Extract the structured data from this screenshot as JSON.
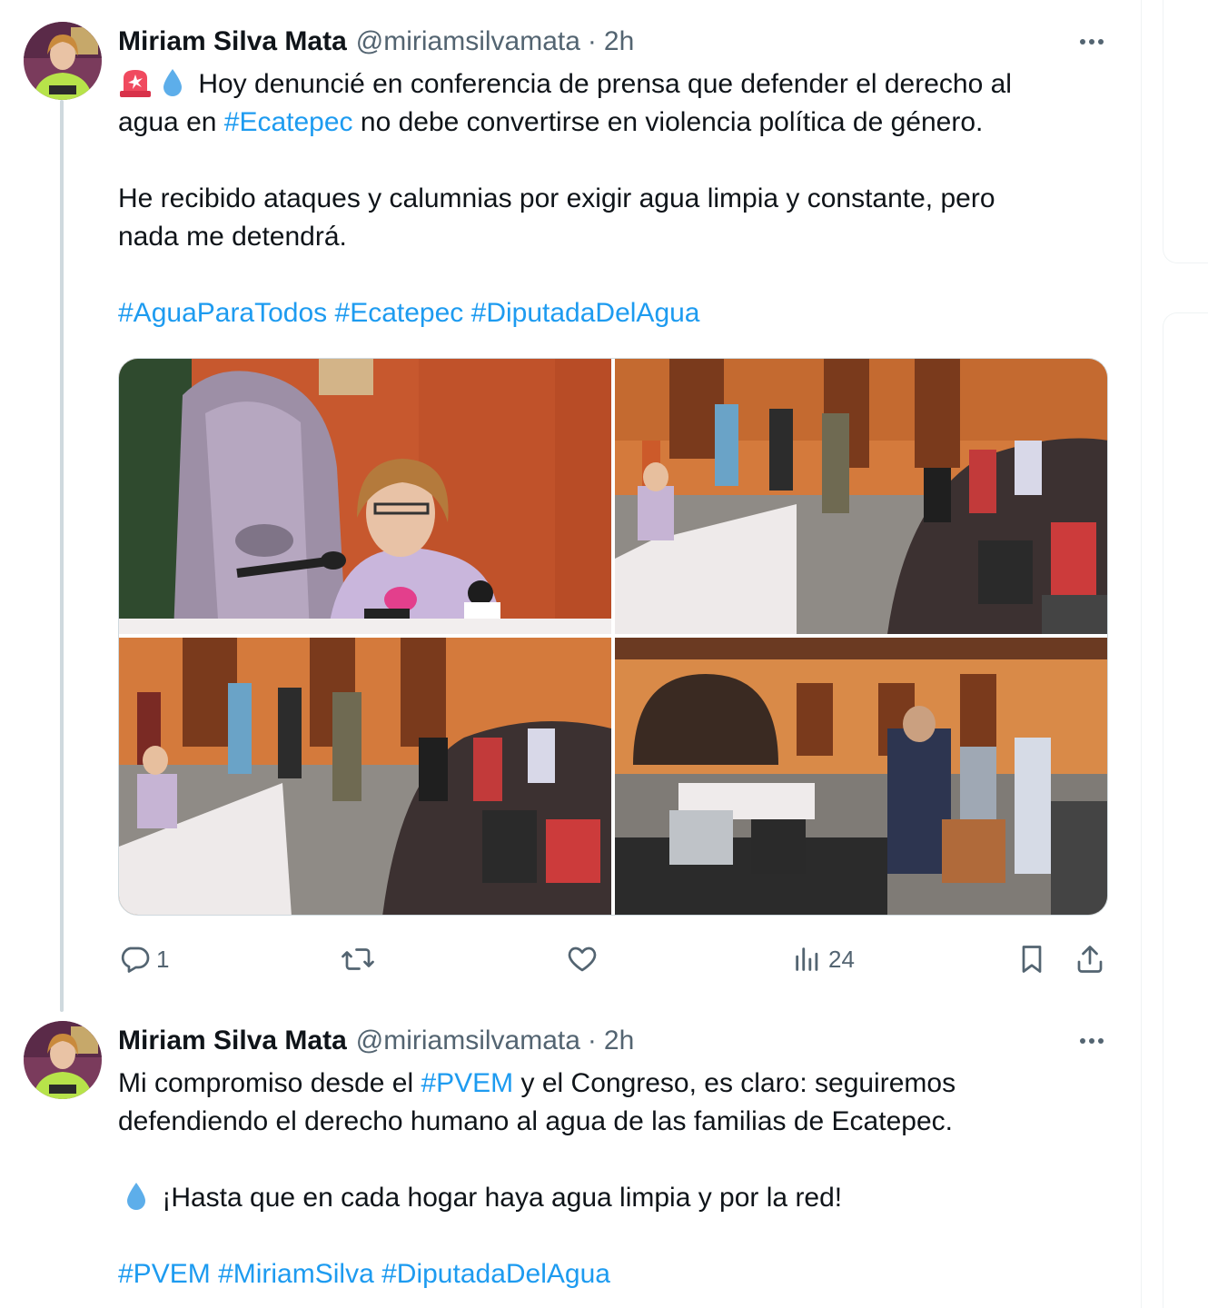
{
  "tweets": [
    {
      "author_name": "Miriam Silva Mata",
      "handle": "@miriamsilvamata",
      "separator": "·",
      "time": "2h",
      "lines": [
        [
          "🚨💧",
          " Hoy denuncié en conferencia de prensa que defender el derecho al"
        ],
        [
          "agua en ",
          "#Ecatepec",
          " no debe convertirse en violencia política de género."
        ],
        [
          "He recibido ataques y calumnias por exigir agua limpia y constante, pero"
        ],
        [
          "nada me detendrá."
        ],
        [
          "#AguaParaTodos",
          " ",
          "#Ecatepec",
          " ",
          "#DiputadaDelAgua"
        ]
      ],
      "photos": [
        {
          "description": "photo-speaker-closeup"
        },
        {
          "description": "photo-press-conference-wide"
        },
        {
          "description": "photo-press-conference-side"
        },
        {
          "description": "photo-courtyard-overview"
        }
      ],
      "stats": {
        "replies": "1",
        "reposts": "",
        "likes": "",
        "views": "24"
      }
    },
    {
      "author_name": "Miriam Silva Mata",
      "handle": "@miriamsilvamata",
      "separator": "·",
      "time": "2h",
      "lines": [
        [
          "Mi compromiso desde el ",
          "#PVEM",
          " y el Congreso, es claro: seguiremos"
        ],
        [
          "defendiendo el derecho humano al agua de las familias de Ecatepec."
        ],
        [
          "💧",
          " ¡Hasta que en cada hogar haya agua limpia y por la red!"
        ],
        [
          "#PVEM",
          " ",
          "#MiriamSilva",
          " ",
          "#DiputadaDelAgua"
        ]
      ]
    }
  ],
  "colors": {
    "text": "#0f1419",
    "secondary": "#536471",
    "link": "#1d9bf0",
    "border": "#cfd9de"
  },
  "icons": [
    "reply-icon",
    "repost-icon",
    "like-icon",
    "views-icon",
    "bookmark-icon",
    "share-icon",
    "more-icon",
    "siren-emoji",
    "droplet-emoji"
  ]
}
